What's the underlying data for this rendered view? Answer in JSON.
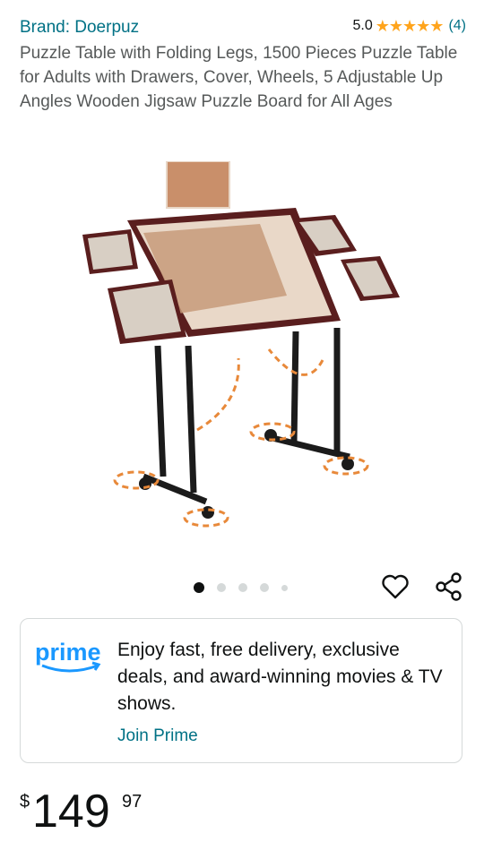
{
  "product": {
    "brand": "Brand: Doerpuz",
    "rating": "5.0",
    "stars": [
      "★",
      "★",
      "★",
      "★",
      "★"
    ],
    "review_count": "(4)",
    "title": "Puzzle Table with Folding Legs, 1500 Pieces Puzzle Table for Adults with Drawers, Cover, Wheels, 5 Adjustable Up Angles Wooden Jigsaw Puzzle Board for All Ages"
  },
  "gallery": {
    "image_count": 5,
    "active_index": 0
  },
  "actions": {
    "favorite_icon": "heart-icon",
    "share_icon": "share-icon"
  },
  "prime": {
    "logo_text": "prime",
    "message": "Enjoy fast, free delivery, exclusive deals, and award-winning movies & TV shows.",
    "join_label": "Join Prime"
  },
  "price": {
    "currency": "$",
    "whole": "149",
    "fraction": "97"
  },
  "colors": {
    "link": "#007185",
    "star": "#ffa41c",
    "text": "#0f1111",
    "muted": "#565959",
    "prime_blue": "#1a98ff"
  }
}
